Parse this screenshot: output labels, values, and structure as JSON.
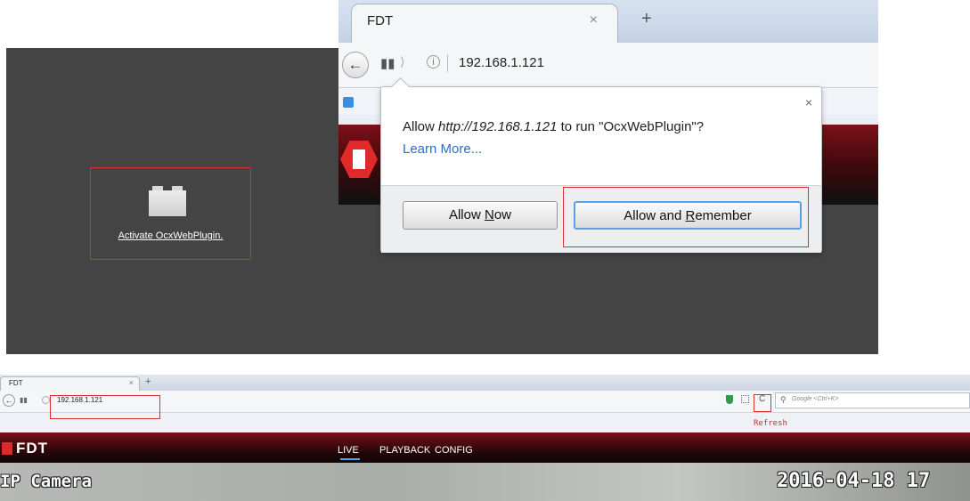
{
  "plugin_panel": {
    "activate_link": "Activate OcxWebPlugin."
  },
  "browser_top": {
    "tab_title": "FDT",
    "tab_close": "×",
    "new_tab": "+",
    "url": "192.168.1.121"
  },
  "popup": {
    "message_prefix": "Allow ",
    "message_url": "http://192.168.1.121",
    "message_suffix": " to run \"OcxWebPlugin\"?",
    "learn_more": "Learn More...",
    "close": "×",
    "allow_now_pre": "Allow ",
    "allow_now_key": "N",
    "allow_now_post": "ow",
    "allow_remember_pre": "Allow and ",
    "allow_remember_key": "R",
    "allow_remember_post": "emember"
  },
  "browser_bottom": {
    "tab_title": "FDT",
    "tab_close": "×",
    "new_tab": "+",
    "url": "192.168.1.121",
    "reload_glyph": "C",
    "search_placeholder": "Google <Ctrl+K>",
    "refresh_label": "Refresh",
    "logo_text": "FDT",
    "menu": [
      "LIVE",
      "PLAYBACK",
      "CONFIG"
    ],
    "camera_label": "IP Camera",
    "datetime": "2016-04-18 17"
  },
  "colors": {
    "annotation_red": "#d9302c",
    "link_blue": "#2a6fce",
    "brand_red": "#e02a2a"
  }
}
